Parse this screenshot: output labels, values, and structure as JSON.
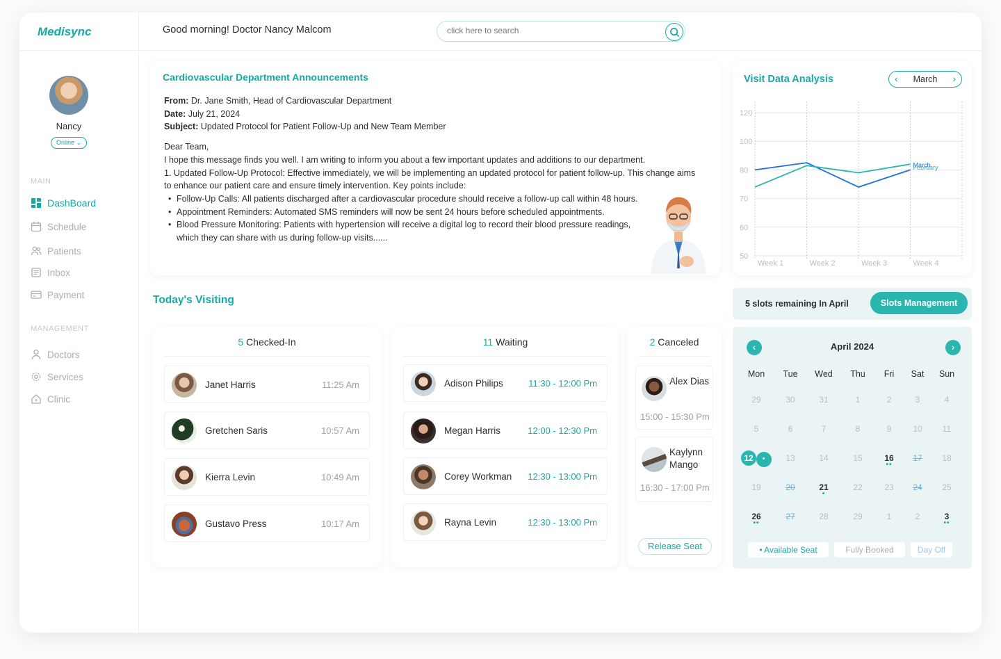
{
  "app": {
    "logo": "Medisync"
  },
  "header": {
    "greeting": "Good morning! Doctor Nancy Malcom",
    "search_placeholder": "click here to search"
  },
  "user": {
    "name": "Nancy",
    "status": "Online ⌄"
  },
  "sidebar": {
    "main_label": "MAIN",
    "management_label": "MANAGEMENT",
    "items": [
      {
        "label": "DashBoard",
        "icon": "dashboard-icon",
        "active": true
      },
      {
        "label": "Schedule",
        "icon": "calendar-icon"
      },
      {
        "label": "Patients",
        "icon": "patients-icon"
      },
      {
        "label": "Inbox",
        "icon": "inbox-icon"
      },
      {
        "label": "Payment",
        "icon": "card-icon"
      }
    ],
    "management_items": [
      {
        "label": "Doctors",
        "icon": "doctor-icon"
      },
      {
        "label": "Services",
        "icon": "gear-icon"
      },
      {
        "label": "Clinic",
        "icon": "home-icon"
      }
    ]
  },
  "announcement": {
    "title": "Cardiovascular Department Announcements",
    "from_label": "From:",
    "from": "Dr. Jane Smith, Head of Cardiovascular Department",
    "date_label": "Date:",
    "date": "July 21, 2024",
    "subject_label": "Subject:",
    "subject": "Updated Protocol for Patient Follow-Up and New Team Member",
    "greeting": "Dear Team,",
    "intro": "I hope this message finds you well. I am writing to inform you about a few important updates and additions to our department.",
    "point1": "1. Updated Follow-Up Protocol: Effective immediately, we will be implementing an updated protocol for patient follow-up. This change aims to enhance our patient care and ensure timely intervention. Key points include:",
    "bullets": [
      "Follow-Up Calls: All patients discharged after a cardiovascular procedure should receive a follow-up call within 48 hours.",
      "Appointment Reminders: Automated SMS reminders will now be sent 24 hours before scheduled appointments.",
      "Blood Pressure Monitoring: Patients with hypertension will receive a digital log to record their blood pressure readings, which they can share with us during follow-up visits......"
    ]
  },
  "visiting": {
    "title": "Today's Visiting",
    "checked_in": {
      "count": "5",
      "label": "Checked-In",
      "rows": [
        {
          "name": "Janet Harris",
          "time": "11:25 Am"
        },
        {
          "name": "Gretchen Saris",
          "time": "10:57 Am"
        },
        {
          "name": "Kierra Levin",
          "time": "10:49 Am"
        },
        {
          "name": "Gustavo Press",
          "time": "10:17 Am"
        }
      ]
    },
    "waiting": {
      "count": "11",
      "label": "Waiting",
      "rows": [
        {
          "name": "Adison Philips",
          "time": "11:30 - 12:00 Pm"
        },
        {
          "name": "Megan Harris",
          "time": "12:00 - 12:30 Pm"
        },
        {
          "name": "Corey Workman",
          "time": "12:30 - 13:00 Pm"
        },
        {
          "name": "Rayna Levin",
          "time": "12:30 - 13:00 Pm"
        }
      ]
    },
    "canceled": {
      "count": "2",
      "label": "Canceled",
      "rows": [
        {
          "name": "Alex Dias",
          "time": "15:00 - 15:30 Pm"
        },
        {
          "name": "Kaylynn Mango",
          "time": "16:30 - 17:00 Pm"
        }
      ],
      "release": "Release Seat"
    }
  },
  "visit_chart": {
    "title": "Visit Data Analysis",
    "month": "March",
    "colors": {
      "march": "#1e6fd9",
      "february": "#2bb5af"
    }
  },
  "chart_data": {
    "type": "line",
    "categories": [
      "Week 1",
      "Week 2",
      "Week 3",
      "Week 4"
    ],
    "y_ticks": [
      120,
      100,
      80,
      70,
      60,
      50
    ],
    "series": [
      {
        "name": "March",
        "values": [
          80,
          85,
          74,
          80
        ]
      },
      {
        "name": "February",
        "values": [
          74,
          83,
          79,
          84
        ]
      }
    ],
    "grid": true
  },
  "slots": {
    "text": "5 slots remaining In April",
    "button": "Slots Management"
  },
  "calendar": {
    "title": "April 2024",
    "prev": "‹",
    "next": "›",
    "weekdays": [
      "Mon",
      "Tue",
      "Wed",
      "Thu",
      "Fri",
      "Sat",
      "Sun"
    ],
    "weeks": [
      [
        "29",
        "30",
        "31",
        "1",
        "2",
        "3",
        "4"
      ],
      [
        "5",
        "6",
        "7",
        "8",
        "9",
        "10",
        "11"
      ],
      [
        "12",
        "13",
        "14",
        "15",
        "16",
        "17",
        "18"
      ],
      [
        "19",
        "20",
        "21",
        "22",
        "23",
        "24",
        "25"
      ],
      [
        "26",
        "27",
        "28",
        "29",
        "1",
        "2",
        "3"
      ]
    ],
    "legend": {
      "available": "• Available Seat",
      "booked": "Fully Booked",
      "dayoff": "Day Off"
    }
  }
}
